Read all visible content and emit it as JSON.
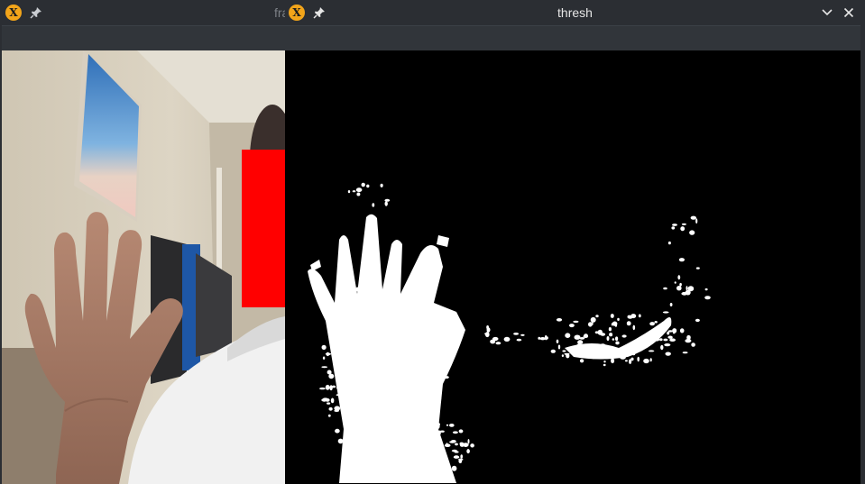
{
  "windows": {
    "frame": {
      "title": "frame"
    },
    "thresh": {
      "title": "thresh"
    }
  },
  "icons": {
    "app": "x-app-icon",
    "pin": "pin-icon",
    "minimize": "chevron-down-icon",
    "close": "close-icon"
  },
  "app_icon_glyph": "X",
  "colors": {
    "titlebar": "#2b2e33",
    "app_icon": "#f3a51a",
    "detection_box": "#ff0000",
    "mask_background": "#000000",
    "mask_foreground": "#ffffff"
  }
}
